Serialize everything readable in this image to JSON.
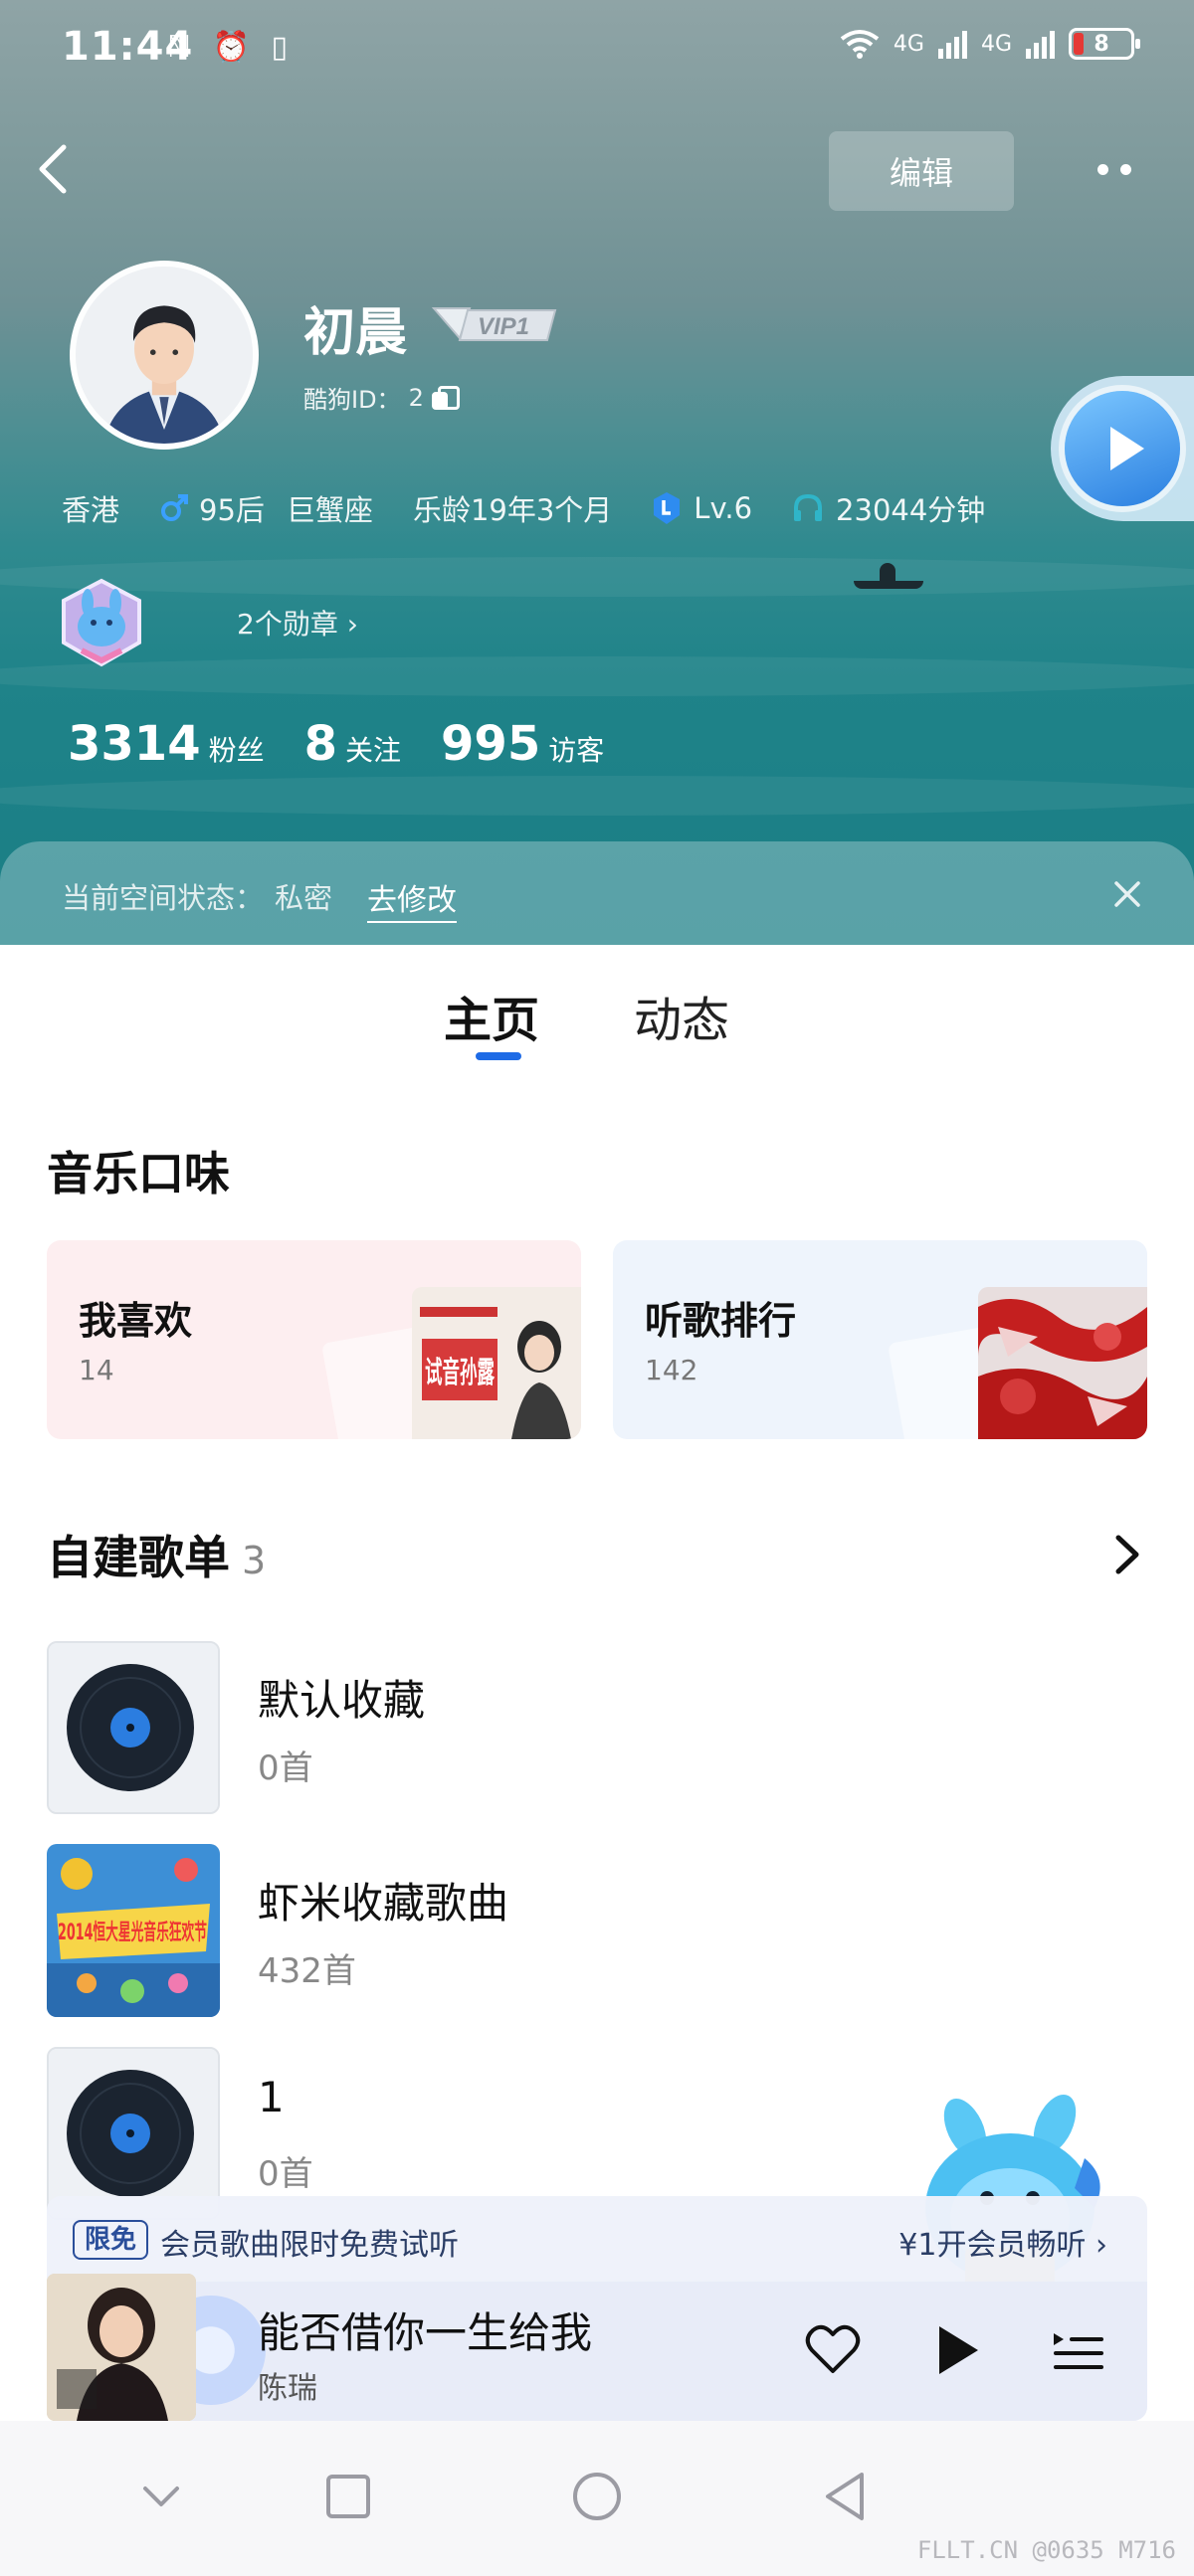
{
  "status_bar": {
    "time": "11:44",
    "indicators": "ℕ ⏰ ▯",
    "network": [
      "4G",
      "4G"
    ],
    "battery": "8"
  },
  "header": {
    "edit_label": "编辑",
    "username": "初晨",
    "vip_label": "VIP1",
    "kugou_id_label": "酷狗ID：",
    "kugou_id_value": "2",
    "info": {
      "location": "香港",
      "age_group": "95后",
      "zodiac": "巨蟹座",
      "music_age": "乐龄19年3个月",
      "level": "Lv.6",
      "listen_time": "23044分钟"
    },
    "medals_link": "2个勋章 ›",
    "stats": [
      {
        "value": "3314",
        "label": "粉丝"
      },
      {
        "value": "8",
        "label": "关注"
      },
      {
        "value": "995",
        "label": "访客"
      }
    ],
    "space_state": {
      "label": "当前空间状态：",
      "value": "私密",
      "link": "去修改"
    }
  },
  "tabs": [
    {
      "label": "主页",
      "active": true
    },
    {
      "label": "动态",
      "active": false
    }
  ],
  "music_taste": {
    "title": "音乐口味",
    "cards": [
      {
        "title": "我喜欢",
        "count": "14",
        "cover_text": "试音孙露"
      },
      {
        "title": "听歌排行",
        "count": "142"
      }
    ]
  },
  "playlists": {
    "title": "自建歌单",
    "count": "3",
    "items": [
      {
        "name": "默认收藏",
        "songs": "0首",
        "cover": "vinyl"
      },
      {
        "name": "虾米收藏歌曲",
        "songs": "432首",
        "cover": "festival",
        "cover_text": "2014恒大星光音乐狂欢节"
      },
      {
        "name": "1",
        "songs": "0首",
        "cover": "vinyl"
      }
    ]
  },
  "promo": {
    "tag": "限免",
    "message": "会员歌曲限时免费试听",
    "cta": "¥1开会员畅听 ›"
  },
  "now_playing": {
    "song": "能否借你一生给我",
    "artist": "陈瑞"
  },
  "watermark": "FLLT.CN @0635 M716",
  "colors": {
    "accent": "#1e6be6",
    "promo_text": "#2b3e66",
    "like_card": "#fdeef0",
    "rank_card": "#eef4fc"
  },
  "icons": [
    "back-icon",
    "more-icon",
    "copy-icon",
    "male-icon",
    "level-icon",
    "headphones-icon",
    "close-icon",
    "chevron-right-icon",
    "heart-icon",
    "play-icon",
    "queue-icon",
    "nav-down-icon",
    "nav-square-icon",
    "nav-circle-icon",
    "nav-back-icon"
  ]
}
